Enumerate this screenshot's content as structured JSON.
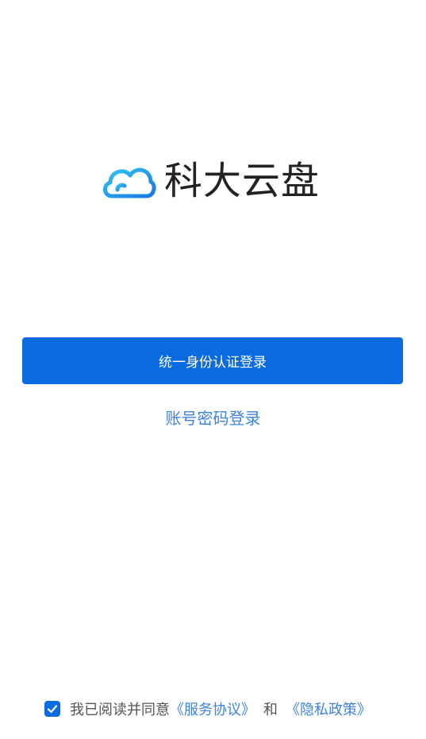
{
  "app": {
    "name": "科大云盘",
    "logo_icon": "cloud-logo-icon",
    "brand_color": "#0b6be0",
    "link_color": "#3b82e3"
  },
  "login": {
    "primary_label": "统一身份认证登录",
    "secondary_label": "账号密码登录"
  },
  "agreement": {
    "checked": true,
    "check_icon": "checkmark-icon",
    "prefix": "我已阅读并同意",
    "terms_label": "《服务协议》",
    "and_label": "和",
    "privacy_label": "《隐私政策》"
  }
}
